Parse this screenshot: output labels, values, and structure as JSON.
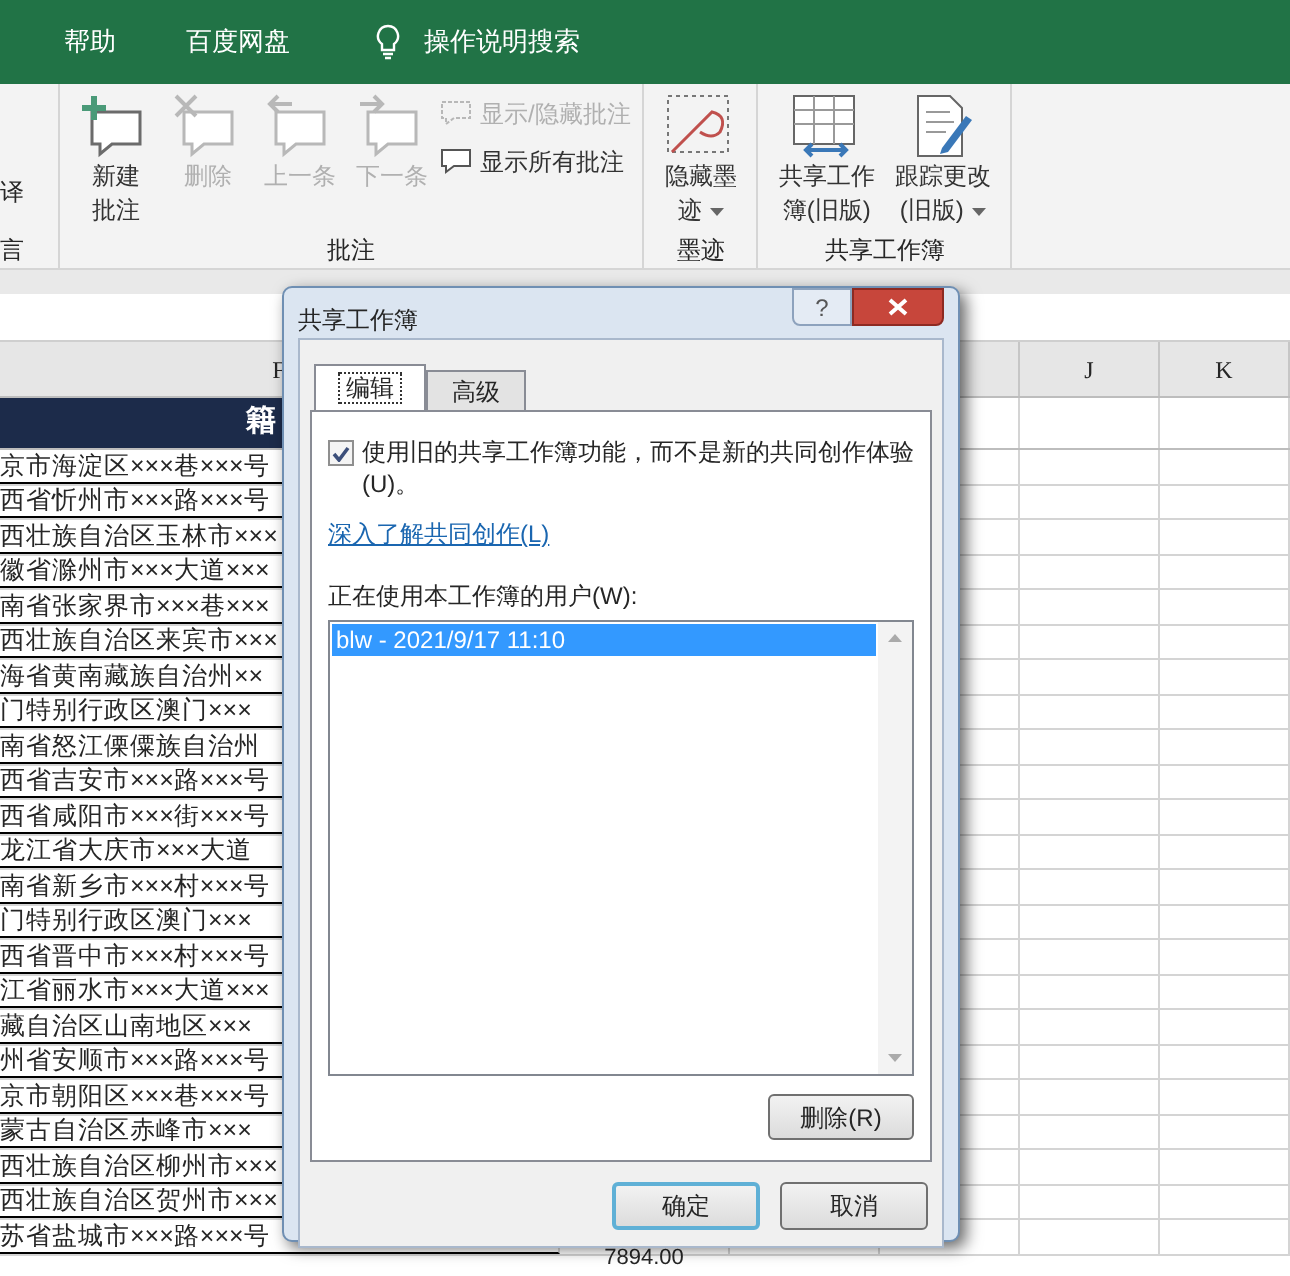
{
  "menu_bar": {
    "items": [
      {
        "label": "帮助"
      },
      {
        "label": "百度网盘"
      }
    ],
    "search_label": "操作说明搜索"
  },
  "ribbon": {
    "cut_group": {
      "button_label": "译",
      "group_label": "言"
    },
    "groups": [
      {
        "label": "批注",
        "buttons": [
          {
            "kind": "add",
            "label_lines": [
              "新建",
              "批注"
            ],
            "dropdown": false,
            "disabled": false
          },
          {
            "kind": "delete",
            "label_lines": [
              "删除"
            ],
            "dropdown": false,
            "disabled": true
          },
          {
            "kind": "previous",
            "label_lines": [
              "上一条"
            ],
            "dropdown": false,
            "disabled": true
          },
          {
            "kind": "next",
            "label_lines": [
              "下一条"
            ],
            "dropdown": false,
            "disabled": true
          }
        ],
        "small_buttons": [
          {
            "kind": "toggle",
            "label": "显示/隐藏批注",
            "disabled": true
          },
          {
            "kind": "show",
            "label": "显示所有批注",
            "disabled": false
          }
        ]
      },
      {
        "label": "墨迹",
        "buttons": [
          {
            "kind": "ink",
            "label_lines": [
              "隐藏墨",
              "迹"
            ],
            "dropdown": true,
            "disabled": false
          }
        ]
      },
      {
        "label": "共享工作簿",
        "buttons": [
          {
            "kind": "share",
            "label_lines": [
              "共享工作",
              "簿(旧版)"
            ],
            "dropdown": false,
            "disabled": false
          },
          {
            "kind": "track",
            "label_lines": [
              "跟踪更改",
              "(旧版)"
            ],
            "dropdown": true,
            "disabled": false
          }
        ]
      }
    ]
  },
  "sheet": {
    "column_headers": [
      "F",
      "J",
      "K"
    ],
    "header_cell": "籍",
    "value_cell": "7894.00",
    "rows": [
      "京市海淀区×××巷×××号",
      "西省忻州市×××路×××号",
      "西壮族自治区玉林市×××",
      "徽省滁州市×××大道×××",
      "南省张家界市×××巷×××",
      "西壮族自治区来宾市×××",
      "海省黄南藏族自治州××",
      "门特别行政区澳门×××",
      "南省怒江傈僳族自治州",
      "西省吉安市×××路×××号",
      "西省咸阳市×××街×××号",
      "龙江省大庆市×××大道",
      "南省新乡市×××村×××号",
      "门特别行政区澳门×××",
      "西省晋中市×××村×××号",
      "江省丽水市×××大道×××",
      "藏自治区山南地区×××",
      "州省安顺市×××路×××号",
      "京市朝阳区×××巷×××号",
      "蒙古自治区赤峰市×××",
      "西壮族自治区柳州市×××",
      "西壮族自治区贺州市×××",
      "苏省盐城市×××路×××号"
    ]
  },
  "dialog": {
    "title": "共享工作簿",
    "help_label": "?",
    "tabs": [
      {
        "label": "编辑",
        "selected": true
      },
      {
        "label": "高级",
        "selected": false
      }
    ],
    "legacy_option": {
      "label": "使用旧的共享工作簿功能，而不是新的共同创作体验(U)。",
      "checked": true
    },
    "link": "深入了解共同创作(L)",
    "users_label": "正在使用本工作簿的用户(W):",
    "users": [
      {
        "label": "blw - 2021/9/17 11:10",
        "selected": true
      }
    ],
    "remove_button": "删除(R)",
    "buttons": [
      {
        "label": "确定",
        "default": true
      },
      {
        "label": "取消",
        "default": false
      }
    ]
  }
}
